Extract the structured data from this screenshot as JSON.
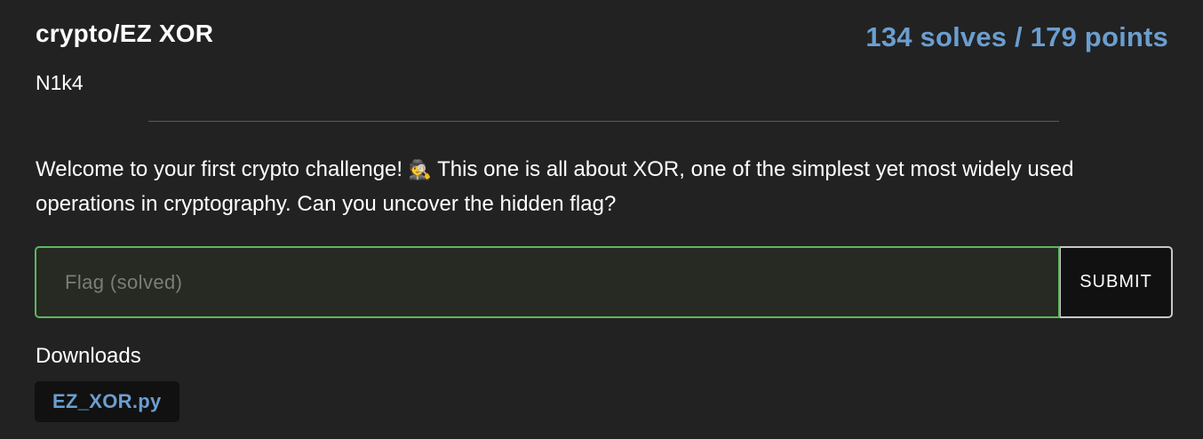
{
  "challenge": {
    "title": "crypto/EZ XOR",
    "stats": "134 solves / 179 points",
    "author": "N1k4",
    "description_before": "Welcome to your first crypto challenge! ",
    "description_emoji": "🕵️",
    "description_after": " This one is all about XOR, one of the simplest yet most widely used operations in cryptography. Can you uncover the hidden flag?"
  },
  "flag_form": {
    "placeholder": "Flag (solved)",
    "value": "",
    "submit_label": "SUBMIT",
    "solved": true
  },
  "downloads": {
    "label": "Downloads",
    "files": [
      {
        "name": "EZ_XOR.py"
      }
    ]
  },
  "colors": {
    "background": "#222222",
    "accent": "#6b9ed0",
    "solved_border": "#5cb85c"
  }
}
